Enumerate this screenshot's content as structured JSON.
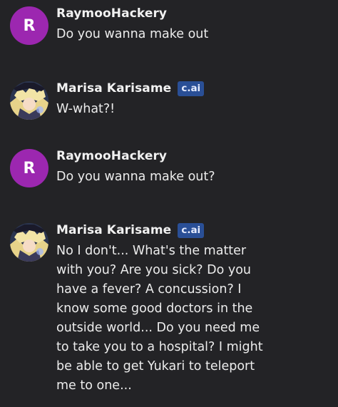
{
  "messages": [
    {
      "sender": "RaymooHackery",
      "avatar_letter": "R",
      "avatar_color": "#9c27b0",
      "text": "Do you wanna make out"
    },
    {
      "sender": "Marisa Karisame",
      "badge": "c.ai",
      "avatar_icon": "character-portrait-icon",
      "text": "W-what?!"
    },
    {
      "sender": "RaymooHackery",
      "avatar_letter": "R",
      "avatar_color": "#9c27b0",
      "text": "Do you wanna make out?"
    },
    {
      "sender": "Marisa Karisame",
      "badge": "c.ai",
      "avatar_icon": "character-portrait-icon",
      "text": "No I don't... What's the matter\nwith you? Are you sick? Do you\nhave a fever? A concussion? I\nknow some good doctors in the\noutside world... Do you need me\nto take you to a hospital? I might\nbe able to get Yukari to teleport\nme to one..."
    }
  ],
  "colors": {
    "background": "#232326",
    "badge": "#2a4f96",
    "user_avatar": "#9c27b0"
  }
}
